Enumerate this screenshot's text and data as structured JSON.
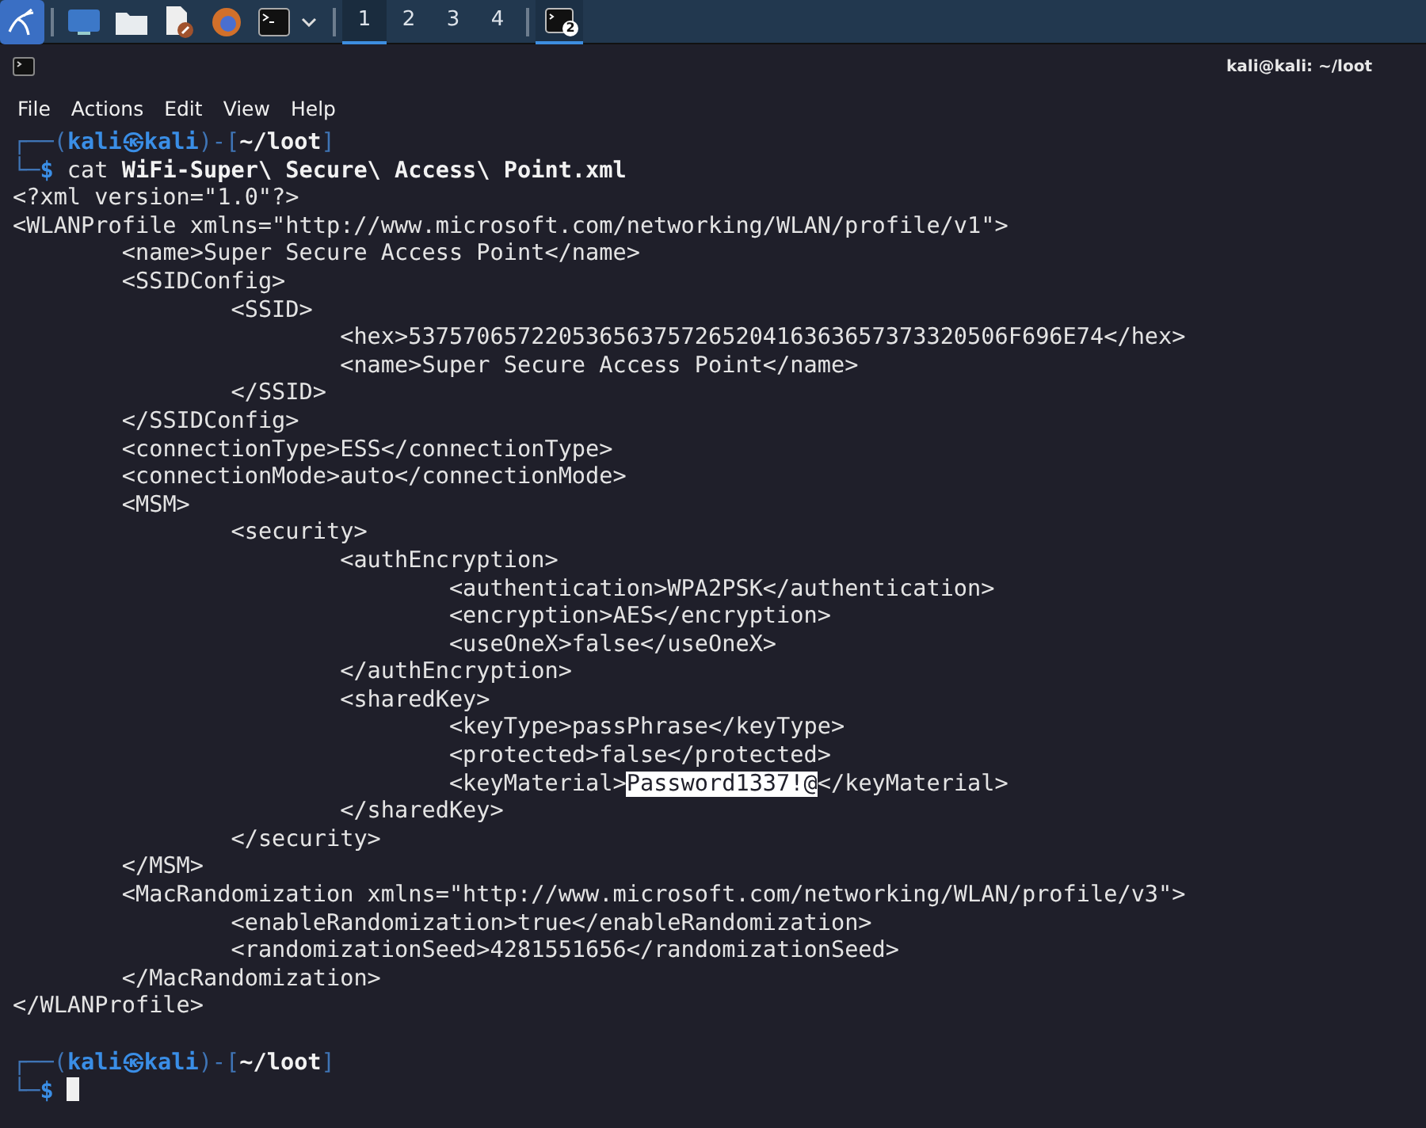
{
  "taskbar": {
    "workspaces": [
      {
        "label": "1",
        "selected": true
      },
      {
        "label": "2",
        "selected": false
      },
      {
        "label": "3",
        "selected": false
      },
      {
        "label": "4",
        "selected": false
      }
    ],
    "task": {
      "badge": "2",
      "selected": true
    }
  },
  "window": {
    "title": "kali@kali: ~/loot"
  },
  "menu": [
    "File",
    "Actions",
    "Edit",
    "View",
    "Help"
  ],
  "terminal": {
    "lines": [
      {
        "segments": [
          {
            "text": "┌──(",
            "kind": "frame"
          },
          {
            "text": "kali㉿kali",
            "kind": "user"
          },
          {
            "text": ")-[",
            "kind": "frame"
          },
          {
            "text": "~/loot",
            "kind": "path"
          },
          {
            "text": "]",
            "kind": "frame"
          }
        ]
      },
      {
        "segments": [
          {
            "text": "└─",
            "kind": "frame"
          },
          {
            "text": "$",
            "kind": "user"
          },
          {
            "text": " cat ",
            "kind": "plain"
          },
          {
            "text": "WiFi-Super\\ Secure\\ Access\\ Point.xml",
            "kind": "bold"
          }
        ]
      },
      {
        "text": "<?xml version=\"1.0\"?>"
      },
      {
        "text": "<WLANProfile xmlns=\"http://www.microsoft.com/networking/WLAN/profile/v1\">"
      },
      {
        "text": "\t<name>Super Secure Access Point</name>"
      },
      {
        "text": "\t<SSIDConfig>"
      },
      {
        "text": "\t\t<SSID>"
      },
      {
        "text": "\t\t\t<hex>53757065722053656375726520416363657373320506F696E74</hex>"
      },
      {
        "text": "\t\t\t<name>Super Secure Access Point</name>"
      },
      {
        "text": "\t\t</SSID>"
      },
      {
        "text": "\t</SSIDConfig>"
      },
      {
        "text": "\t<connectionType>ESS</connectionType>"
      },
      {
        "text": "\t<connectionMode>auto</connectionMode>"
      },
      {
        "text": "\t<MSM>"
      },
      {
        "text": "\t\t<security>"
      },
      {
        "text": "\t\t\t<authEncryption>"
      },
      {
        "text": "\t\t\t\t<authentication>WPA2PSK</authentication>"
      },
      {
        "text": "\t\t\t\t<encryption>AES</encryption>"
      },
      {
        "text": "\t\t\t\t<useOneX>false</useOneX>"
      },
      {
        "text": "\t\t\t</authEncryption>"
      },
      {
        "text": "\t\t\t<sharedKey>"
      },
      {
        "text": "\t\t\t\t<keyType>passPhrase</keyType>"
      },
      {
        "text": "\t\t\t\t<protected>false</protected>"
      },
      {
        "segments": [
          {
            "text": "\t\t\t\t<keyMaterial>",
            "kind": "plain"
          },
          {
            "text": "Password1337!@",
            "kind": "selected"
          },
          {
            "text": "</keyMaterial>",
            "kind": "plain"
          }
        ]
      },
      {
        "text": "\t\t\t</sharedKey>"
      },
      {
        "text": "\t\t</security>"
      },
      {
        "text": "\t</MSM>"
      },
      {
        "text": "\t<MacRandomization xmlns=\"http://www.microsoft.com/networking/WLAN/profile/v3\">"
      },
      {
        "text": "\t\t<enableRandomization>true</enableRandomization>"
      },
      {
        "text": "\t\t<randomizationSeed>4281551656</randomizationSeed>"
      },
      {
        "text": "\t</MacRandomization>"
      },
      {
        "text": "</WLANProfile>"
      },
      {
        "segments": [
          {
            "text": "┌──(",
            "kind": "frame"
          },
          {
            "text": "kali㉿kali",
            "kind": "user"
          },
          {
            "text": ")-[",
            "kind": "frame"
          },
          {
            "text": "~/loot",
            "kind": "path"
          },
          {
            "text": "]",
            "kind": "frame"
          }
        ],
        "blank_before": true
      },
      {
        "segments": [
          {
            "text": "└─",
            "kind": "frame"
          },
          {
            "text": "$",
            "kind": "user"
          }
        ],
        "cursor": true
      }
    ]
  }
}
